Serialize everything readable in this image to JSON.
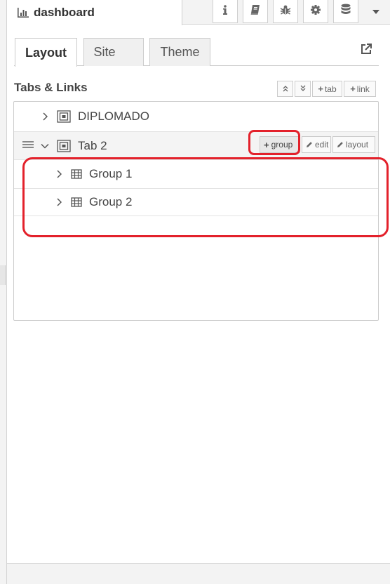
{
  "header": {
    "title": "dashboard",
    "title_icon": "bar-chart-icon",
    "buttons": [
      "info-icon",
      "book-icon",
      "bug-icon",
      "gear-icon",
      "database-icon"
    ],
    "dropdown_icon": "caret-down-icon"
  },
  "subtabs": [
    {
      "label": "Layout",
      "active": true
    },
    {
      "label": "Site",
      "active": false
    },
    {
      "label": "Theme",
      "active": false
    }
  ],
  "section": {
    "title": "Tabs & Links",
    "tools": {
      "expand_icon": "chevrons-up-icon",
      "collapse_icon": "chevrons-down-icon",
      "add_tab": "tab",
      "add_link": "link"
    }
  },
  "tree": {
    "tabs": [
      {
        "label": "DIPLOMADO",
        "expanded": false
      },
      {
        "label": "Tab 2",
        "expanded": true,
        "actions": {
          "group": "group",
          "edit": "edit",
          "layout": "layout"
        },
        "groups": [
          {
            "label": "Group 1"
          },
          {
            "label": "Group 2"
          }
        ]
      }
    ]
  },
  "colors": {
    "highlight": "#e3212b",
    "border": "#cccccc",
    "panel": "#f3f3f3"
  }
}
